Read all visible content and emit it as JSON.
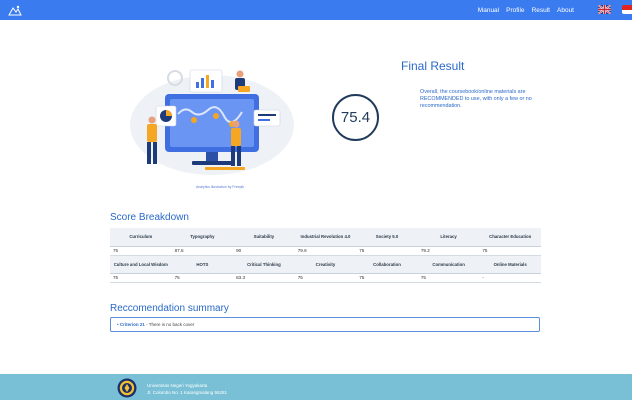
{
  "navbar": {
    "logo_icon": "app-logo-icon",
    "links": [
      {
        "label": "Manual"
      },
      {
        "label": "Profile"
      },
      {
        "label": "Result"
      },
      {
        "label": "About"
      }
    ],
    "flags": [
      "uk-flag-icon",
      "indonesia-flag-icon"
    ],
    "bg_color": "#3a7cf0"
  },
  "hero": {
    "illustration_credit": "Analytics illustration by Freepik",
    "score": "75.4",
    "title": "Final Result",
    "description": "Overall, the coursebook/online materials are RECOMMENDED to use, with only a few or no recommendation."
  },
  "score_breakdown": {
    "title": "Score Breakdown",
    "header_1": [
      "Curriculum",
      "Typography",
      "Suitability",
      "Industrial Revolution 4.0",
      "Society 5.0",
      "Literacy",
      "Character Education"
    ],
    "values_1": [
      "75",
      "87.5",
      "90",
      "79.6",
      "75",
      "79.2",
      "75"
    ],
    "header_2": [
      "Culture and Local Wisdom",
      "HOTS",
      "Critical Thinking",
      "Creativity",
      "Collaboration",
      "Communication",
      "Online Materials"
    ],
    "values_2": [
      "75",
      "75",
      "83.3",
      "75",
      "75",
      "75",
      "-"
    ]
  },
  "recommendation": {
    "title": "Reccomendation summary",
    "items": [
      {
        "criterion": "Criterion 21",
        "text": " - There is no back cover"
      }
    ]
  },
  "footer": {
    "logo_icon": "university-seal-icon",
    "line1": "Universitas Negeri Yogyakarta",
    "line2": "Jl. Colombo No. 1 Karangmalang 55281",
    "bg_color": "#79c0d6"
  }
}
